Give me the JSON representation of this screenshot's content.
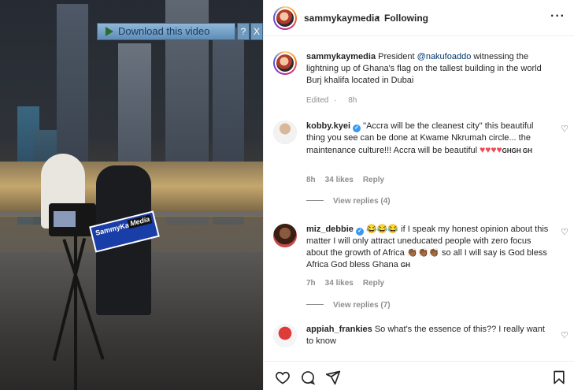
{
  "video": {
    "download_button_label": "Download this video",
    "help_label": "?",
    "close_label": "X",
    "watermark_name": "SammyKay",
    "watermark_tag": "Media"
  },
  "header": {
    "username": "sammykaymedia",
    "separator": "•",
    "follow_status": "Following",
    "more_label": "···"
  },
  "caption": {
    "username": "sammykaymedia",
    "text_before": " President ",
    "mention": "@nakufoaddo",
    "text_after": " witnessing the lightning up of Ghana's flag on the tallest building in the world Burj khalifa located in Dubai",
    "edited": "Edited",
    "time": "8h"
  },
  "comments": [
    {
      "username": "kobby.kyei",
      "verified_mark": "✓",
      "text": " \"Accra will be the cleanest city\" this beautiful thing you see can be done at Kwame Nkrumah circle... the maintenance culture!!! Accra will be beautiful ",
      "hearts": "♥♥♥♥",
      "flags": "GHGH GH",
      "time": "8h",
      "likes": "34 likes",
      "reply": "Reply",
      "view_replies": "View replies (4)"
    },
    {
      "username": "miz_debbie",
      "verified_mark": "✓",
      "emoji_lead": "😂😂😂",
      "text_a": " if I speak my honest opinion about this matter I will only attract uneducated people with zero focus about the growth of Africa ",
      "emoji_mid": "👏🏾👏🏾👏🏾",
      "text_b": " so all I will say is God bless Africa God bless Ghana ",
      "flag": "GH",
      "time": "7h",
      "likes": "34 likes",
      "reply": "Reply",
      "view_replies": "View replies (7)"
    },
    {
      "username": "appiah_frankies",
      "text": " So what's the essence of this?? I really want to know"
    }
  ],
  "icons": {
    "like": "heart-outline-icon",
    "comment": "comment-icon",
    "share": "paper-plane-icon",
    "save": "bookmark-icon"
  }
}
